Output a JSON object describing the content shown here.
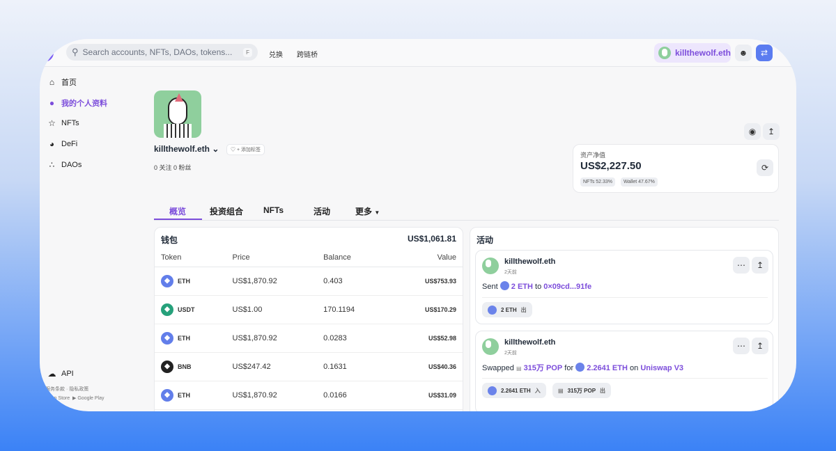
{
  "topbar": {
    "search_placeholder": "Search accounts, NFTs, DAOs, tokens...",
    "search_shortcut": "F",
    "nav": [
      "兑换",
      "跨链桥"
    ],
    "account": "killthewolf.eth"
  },
  "sidebar": {
    "items": [
      {
        "label": "首页",
        "icon": "home-icon"
      },
      {
        "label": "我的个人资料",
        "icon": "user-icon"
      },
      {
        "label": "NFTs",
        "icon": "star-icon"
      },
      {
        "label": "DeFi",
        "icon": "gauge-icon"
      },
      {
        "label": "DAOs",
        "icon": "dao-icon"
      }
    ],
    "api": "API",
    "terms": "服务条款",
    "privacy": "隐私政策",
    "app_store": "App Store",
    "google_play": "Google Play"
  },
  "profile": {
    "name": "killthewolf.eth",
    "add_tag": "+ 添加标签",
    "following": "0 关注",
    "followers": "0 粉丝"
  },
  "networth": {
    "label": "资产净值",
    "value": "US$2,227.50",
    "nfts": "NFTs 52.33%",
    "wallet": "Wallet 47.67%"
  },
  "tabs": [
    "概览",
    "投资组合",
    "NFTs",
    "活动",
    "更多"
  ],
  "wallet": {
    "title": "钱包",
    "total": "US$1,061.81",
    "columns": [
      "Token",
      "Price",
      "Balance",
      "Value"
    ],
    "rows": [
      {
        "token": "ETH",
        "price": "US$1,870.92",
        "balance": "0.403",
        "value": "US$753.93",
        "color": "#627eea"
      },
      {
        "token": "USDT",
        "price": "US$1.00",
        "balance": "170.1194",
        "value": "US$170.29",
        "color": "#26a17b"
      },
      {
        "token": "ETH",
        "price": "US$1,870.92",
        "balance": "0.0283",
        "value": "US$52.98",
        "color": "#627eea"
      },
      {
        "token": "BNB",
        "price": "US$247.42",
        "balance": "0.1631",
        "value": "US$40.36",
        "color": "#222"
      },
      {
        "token": "ETH",
        "price": "US$1,870.92",
        "balance": "0.0166",
        "value": "US$31.09",
        "color": "#627eea"
      }
    ]
  },
  "activity": {
    "title": "活动",
    "items": [
      {
        "user": "killthewolf.eth",
        "time": "2天前",
        "verb": "Sent",
        "amount": "2 ETH",
        "mid": "to",
        "target": "0×09cd...91fe",
        "chips": [
          {
            "label": "2 ETH",
            "dir": "出"
          }
        ]
      },
      {
        "user": "killthewolf.eth",
        "time": "2天前",
        "verb": "Swapped",
        "amount": "315万 POP",
        "mid": "for",
        "amount2": "2.2641 ETH",
        "mid2": "on",
        "target": "Uniswap V3",
        "chips": [
          {
            "label": "2.2641 ETH",
            "dir": "入"
          },
          {
            "label": "315万 POP",
            "dir": "出"
          }
        ]
      }
    ]
  }
}
